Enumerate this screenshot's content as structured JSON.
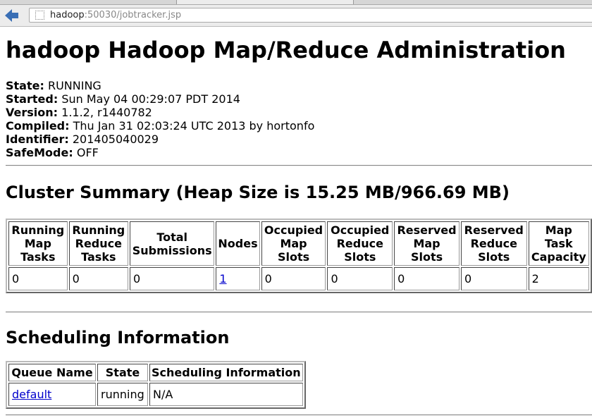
{
  "browser": {
    "url_host": "hadoop",
    "url_path": ":50030/jobtracker.jsp"
  },
  "title": "hadoop Hadoop Map/Reduce Administration",
  "info": [
    {
      "label": "State:",
      "value": "RUNNING"
    },
    {
      "label": "Started:",
      "value": "Sun May 04 00:29:07 PDT 2014"
    },
    {
      "label": "Version:",
      "value": "1.1.2, r1440782"
    },
    {
      "label": "Compiled:",
      "value": "Thu Jan 31 02:03:24 UTC 2013 by hortonfo"
    },
    {
      "label": "Identifier:",
      "value": "201405040029"
    },
    {
      "label": "SafeMode:",
      "value": "OFF"
    }
  ],
  "cluster": {
    "heading": "Cluster Summary (Heap Size is 15.25 MB/966.69 MB)",
    "headers": [
      "Running Map Tasks",
      "Running Reduce Tasks",
      "Total Submissions",
      "Nodes",
      "Occupied Map Slots",
      "Occupied Reduce Slots",
      "Reserved Map Slots",
      "Reserved Reduce Slots",
      "Map Task Capacity"
    ],
    "values": [
      "0",
      "0",
      "0",
      "1",
      "0",
      "0",
      "0",
      "0",
      "2"
    ]
  },
  "scheduling": {
    "heading": "Scheduling Information",
    "headers": [
      "Queue Name",
      "State",
      "Scheduling Information"
    ],
    "rows": [
      [
        "default",
        "running",
        "N/A"
      ]
    ]
  }
}
